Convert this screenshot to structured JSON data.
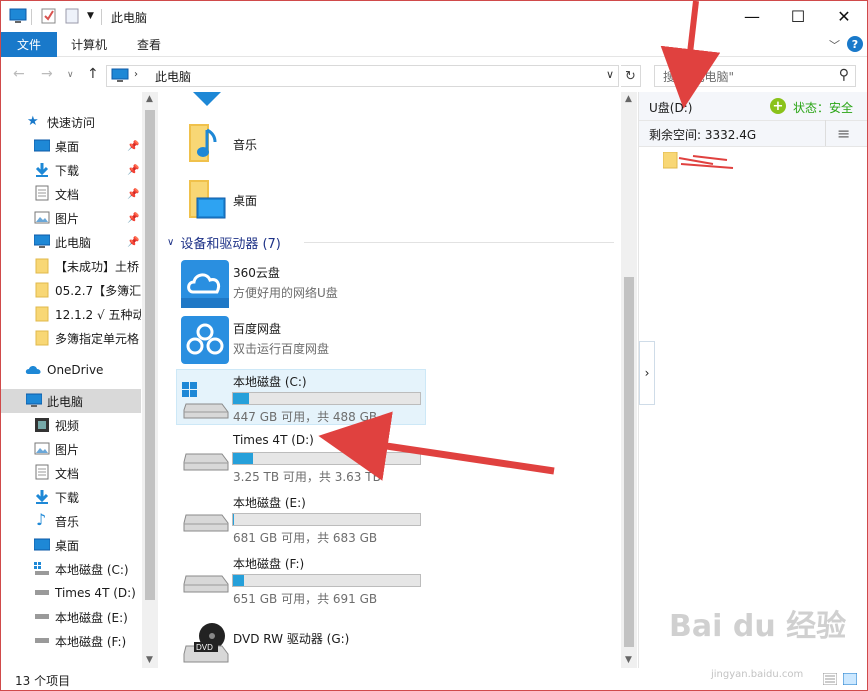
{
  "window": {
    "title": "此电脑",
    "minimize": "—",
    "maximize": "☐",
    "close": "✕"
  },
  "ribbon": {
    "tabs": [
      "文件",
      "计算机",
      "查看"
    ],
    "expand": "﹀",
    "help": "?"
  },
  "address": {
    "crumb": "此电脑",
    "separator": "›",
    "search_placeholder": "搜索\"此电脑\""
  },
  "nav": {
    "quick_access": "快速访问",
    "pinned": [
      {
        "label": "桌面",
        "icon": "desktop-icon"
      },
      {
        "label": "下载",
        "icon": "download-icon"
      },
      {
        "label": "文档",
        "icon": "document-icon"
      },
      {
        "label": "图片",
        "icon": "picture-icon"
      },
      {
        "label": "此电脑",
        "icon": "computer-icon"
      }
    ],
    "recent": [
      "【未成功】土桥",
      "05.2.7【多簿汇",
      "12.1.2 √ 五种动",
      "多簿指定单元格"
    ],
    "onedrive": "OneDrive",
    "this_pc": "此电脑",
    "pc_items": [
      {
        "label": "视频",
        "icon": "video-icon"
      },
      {
        "label": "图片",
        "icon": "picture-icon"
      },
      {
        "label": "文档",
        "icon": "document-icon"
      },
      {
        "label": "下载",
        "icon": "download-icon"
      },
      {
        "label": "音乐",
        "icon": "music-icon"
      },
      {
        "label": "桌面",
        "icon": "desktop-icon"
      },
      {
        "label": "本地磁盘 (C:)",
        "icon": "windows-drive-icon"
      },
      {
        "label": "Times 4T (D:)",
        "icon": "drive-icon"
      },
      {
        "label": "本地磁盘 (E:)",
        "icon": "drive-icon"
      },
      {
        "label": "本地磁盘 (F:)",
        "icon": "drive-icon"
      }
    ]
  },
  "content": {
    "folders": [
      {
        "label": "音乐",
        "icon": "music-folder-icon"
      },
      {
        "label": "桌面",
        "icon": "desktop-folder-icon"
      }
    ],
    "devices_header": "设备和驱动器 (7)",
    "devices": [
      {
        "name": "360云盘",
        "sub": "方便好用的网络U盘",
        "type": "cloud",
        "icon": "cloud-360-icon"
      },
      {
        "name": "百度网盘",
        "sub": "双击运行百度网盘",
        "type": "cloud",
        "icon": "baidu-netdisk-icon"
      },
      {
        "name": "本地磁盘 (C:)",
        "cap": "447 GB 可用，共 488 GB",
        "used_fraction": 0.084,
        "selected": true,
        "icon": "windows-drive-icon"
      },
      {
        "name": "Times 4T (D:)",
        "cap": "3.25 TB 可用，共 3.63 TB",
        "used_fraction": 0.105,
        "icon": "drive-icon"
      },
      {
        "name": "本地磁盘 (E:)",
        "cap": "681 GB 可用，共 683 GB",
        "used_fraction": 0.003,
        "icon": "drive-icon"
      },
      {
        "name": "本地磁盘 (F:)",
        "cap": "651 GB 可用，共 691 GB",
        "used_fraction": 0.058,
        "icon": "drive-icon"
      },
      {
        "name": "DVD RW 驱动器 (G:)",
        "type": "dvd",
        "icon": "dvd-drive-icon"
      }
    ]
  },
  "preview": {
    "drive": "U盘(D:)",
    "status": "状态：安全",
    "free_space": "剩余空间: 3332.4G"
  },
  "status": {
    "count": "13 个项目"
  },
  "watermark": {
    "text": "Bai du 经验",
    "url": "jingyan.baidu.com"
  },
  "colors": {
    "accent": "#1979ca",
    "bar_fill": "#26a0da",
    "arrow": "#e0413f",
    "group_header": "#1e3287",
    "safe_green": "#2aa515"
  }
}
